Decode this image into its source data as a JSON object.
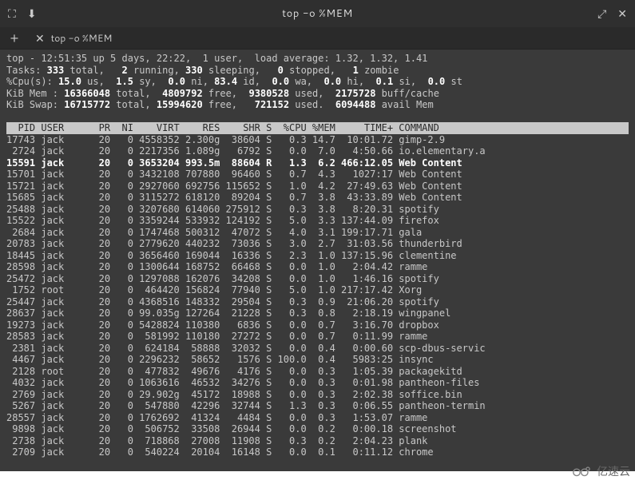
{
  "window": {
    "title": "top -o %MEM",
    "titlebar_icons": {
      "fullscreen": "⛶",
      "download": "⬇",
      "expand": "⤢",
      "close": "✕"
    }
  },
  "tabs": {
    "new_tab_icon": "+",
    "items": [
      {
        "close_icon": "✕",
        "label": "top -o %MEM"
      }
    ]
  },
  "summary": {
    "line1_pre": "top - 12:51:35 up 5 days, 22:22,  1 user,  load average: 1.32, 1.32, 1.41",
    "tasks_label": "Tasks:",
    "tasks_total": "333",
    "tasks_total_suffix": " total,",
    "tasks_running": "2",
    "tasks_running_suffix": " running,",
    "tasks_sleeping": "330",
    "tasks_sleeping_suffix": " sleeping,",
    "tasks_stopped": "0",
    "tasks_stopped_suffix": " stopped,",
    "tasks_zombie": "1",
    "tasks_zombie_suffix": " zombie",
    "cpu_label": "%Cpu(s):",
    "cpu_us": "15.0",
    "cpu_us_suffix": " us,",
    "cpu_sy": "1.5",
    "cpu_sy_suffix": " sy,",
    "cpu_ni": "0.0",
    "cpu_ni_suffix": " ni,",
    "cpu_id": "83.4",
    "cpu_id_suffix": " id,",
    "cpu_wa": "0.0",
    "cpu_wa_suffix": " wa,",
    "cpu_hi": "0.0",
    "cpu_hi_suffix": " hi,",
    "cpu_si": "0.1",
    "cpu_si_suffix": " si,",
    "cpu_st": "0.0",
    "cpu_st_suffix": " st",
    "mem_label": "KiB Mem :",
    "mem_total": "16366048",
    "mem_total_suffix": " total,",
    "mem_free": "4809792",
    "mem_free_suffix": " free,",
    "mem_used": "9380528",
    "mem_used_suffix": " used,",
    "mem_cache": "2175728",
    "mem_cache_suffix": " buff/cache",
    "swap_label": "KiB Swap:",
    "swap_total": "16715772",
    "swap_total_suffix": " total,",
    "swap_free": "15994620",
    "swap_free_suffix": " free,",
    "swap_used": "721152",
    "swap_used_suffix": " used.",
    "swap_avail": "6094488",
    "swap_avail_suffix": " avail Mem"
  },
  "columns": "  PID USER      PR  NI    VIRT    RES    SHR S  %CPU %MEM     TIME+ COMMAND         ",
  "rows": [
    {
      "hl": false,
      "pid": "17743",
      "user": "jack",
      "pr": "20",
      "ni": "0",
      "virt": "4558352",
      "res": "2.300g",
      "shr": "38604",
      "s": "S",
      "cpu": "0.3",
      "mem": "14.7",
      "time": "10:01.72",
      "cmd": "gimp-2.9"
    },
    {
      "hl": false,
      "pid": " 2724",
      "user": "jack",
      "pr": "20",
      "ni": "0",
      "virt": "2217356",
      "res": "1.089g",
      "shr": "6792",
      "s": "S",
      "cpu": "0.0",
      "mem": "7.0",
      "time": "4:50.66",
      "cmd": "io.elementary.a"
    },
    {
      "hl": true,
      "pid": "15591",
      "user": "jack",
      "pr": "20",
      "ni": "0",
      "virt": "3653204",
      "res": "993.5m",
      "shr": "88604",
      "s": "R",
      "cpu": "1.3",
      "mem": "6.2",
      "time": "466:12.05",
      "cmd": "Web Content"
    },
    {
      "hl": false,
      "pid": "15701",
      "user": "jack",
      "pr": "20",
      "ni": "0",
      "virt": "3432108",
      "res": "707880",
      "shr": "96460",
      "s": "S",
      "cpu": "0.7",
      "mem": "4.3",
      "time": "1027:17",
      "cmd": "Web Content"
    },
    {
      "hl": false,
      "pid": "15721",
      "user": "jack",
      "pr": "20",
      "ni": "0",
      "virt": "2927060",
      "res": "692756",
      "shr": "115652",
      "s": "S",
      "cpu": "1.0",
      "mem": "4.2",
      "time": "27:49.63",
      "cmd": "Web Content"
    },
    {
      "hl": false,
      "pid": "15685",
      "user": "jack",
      "pr": "20",
      "ni": "0",
      "virt": "3115272",
      "res": "618120",
      "shr": "89204",
      "s": "S",
      "cpu": "0.7",
      "mem": "3.8",
      "time": "43:33.89",
      "cmd": "Web Content"
    },
    {
      "hl": false,
      "pid": "25488",
      "user": "jack",
      "pr": "20",
      "ni": "0",
      "virt": "3207680",
      "res": "614060",
      "shr": "275912",
      "s": "S",
      "cpu": "0.3",
      "mem": "3.8",
      "time": "8:20.31",
      "cmd": "spotify"
    },
    {
      "hl": false,
      "pid": "15522",
      "user": "jack",
      "pr": "20",
      "ni": "0",
      "virt": "3359244",
      "res": "533932",
      "shr": "124192",
      "s": "S",
      "cpu": "5.0",
      "mem": "3.3",
      "time": "137:44.09",
      "cmd": "firefox"
    },
    {
      "hl": false,
      "pid": " 2684",
      "user": "jack",
      "pr": "20",
      "ni": "0",
      "virt": "1747468",
      "res": "500312",
      "shr": "47072",
      "s": "S",
      "cpu": "4.0",
      "mem": "3.1",
      "time": "199:17.71",
      "cmd": "gala"
    },
    {
      "hl": false,
      "pid": "20783",
      "user": "jack",
      "pr": "20",
      "ni": "0",
      "virt": "2779620",
      "res": "440232",
      "shr": "73036",
      "s": "S",
      "cpu": "3.0",
      "mem": "2.7",
      "time": "31:03.56",
      "cmd": "thunderbird"
    },
    {
      "hl": false,
      "pid": "18445",
      "user": "jack",
      "pr": "20",
      "ni": "0",
      "virt": "3656460",
      "res": "169044",
      "shr": "16336",
      "s": "S",
      "cpu": "2.3",
      "mem": "1.0",
      "time": "137:15.96",
      "cmd": "clementine"
    },
    {
      "hl": false,
      "pid": "28598",
      "user": "jack",
      "pr": "20",
      "ni": "0",
      "virt": "1300644",
      "res": "168752",
      "shr": "66468",
      "s": "S",
      "cpu": "0.0",
      "mem": "1.0",
      "time": "2:04.42",
      "cmd": "ramme"
    },
    {
      "hl": false,
      "pid": "25472",
      "user": "jack",
      "pr": "20",
      "ni": "0",
      "virt": "1297088",
      "res": "162076",
      "shr": "34208",
      "s": "S",
      "cpu": "0.0",
      "mem": "1.0",
      "time": "1:46.16",
      "cmd": "spotify"
    },
    {
      "hl": false,
      "pid": " 1752",
      "user": "root",
      "pr": "20",
      "ni": "0",
      "virt": "464420",
      "res": "156824",
      "shr": "77940",
      "s": "S",
      "cpu": "5.0",
      "mem": "1.0",
      "time": "217:17.42",
      "cmd": "Xorg"
    },
    {
      "hl": false,
      "pid": "25447",
      "user": "jack",
      "pr": "20",
      "ni": "0",
      "virt": "4368516",
      "res": "148332",
      "shr": "29504",
      "s": "S",
      "cpu": "0.3",
      "mem": "0.9",
      "time": "21:06.20",
      "cmd": "spotify"
    },
    {
      "hl": false,
      "pid": "28637",
      "user": "jack",
      "pr": "20",
      "ni": "0",
      "virt": "99.035g",
      "res": "127264",
      "shr": "21228",
      "s": "S",
      "cpu": "0.3",
      "mem": "0.8",
      "time": "2:18.19",
      "cmd": "wingpanel"
    },
    {
      "hl": false,
      "pid": "19273",
      "user": "jack",
      "pr": "20",
      "ni": "0",
      "virt": "5428824",
      "res": "110380",
      "shr": "6836",
      "s": "S",
      "cpu": "0.0",
      "mem": "0.7",
      "time": "3:16.70",
      "cmd": "dropbox"
    },
    {
      "hl": false,
      "pid": "28583",
      "user": "jack",
      "pr": "20",
      "ni": "0",
      "virt": "581992",
      "res": "110180",
      "shr": "27272",
      "s": "S",
      "cpu": "0.0",
      "mem": "0.7",
      "time": "0:11.99",
      "cmd": "ramme"
    },
    {
      "hl": false,
      "pid": " 2381",
      "user": "jack",
      "pr": "20",
      "ni": "0",
      "virt": "624184",
      "res": "58888",
      "shr": "32032",
      "s": "S",
      "cpu": "0.0",
      "mem": "0.4",
      "time": "0:00.60",
      "cmd": "scp-dbus-servic"
    },
    {
      "hl": false,
      "pid": " 4467",
      "user": "jack",
      "pr": "20",
      "ni": "0",
      "virt": "2296232",
      "res": "58652",
      "shr": "1576",
      "s": "S",
      "cpu": "100.0",
      "mem": "0.4",
      "time": "5983:25",
      "cmd": "insync"
    },
    {
      "hl": false,
      "pid": " 2128",
      "user": "root",
      "pr": "20",
      "ni": "0",
      "virt": "477832",
      "res": "49676",
      "shr": "4176",
      "s": "S",
      "cpu": "0.0",
      "mem": "0.3",
      "time": "1:05.39",
      "cmd": "packagekitd"
    },
    {
      "hl": false,
      "pid": " 4032",
      "user": "jack",
      "pr": "20",
      "ni": "0",
      "virt": "1063616",
      "res": "46532",
      "shr": "34276",
      "s": "S",
      "cpu": "0.0",
      "mem": "0.3",
      "time": "0:01.98",
      "cmd": "pantheon-files"
    },
    {
      "hl": false,
      "pid": " 2769",
      "user": "jack",
      "pr": "20",
      "ni": "0",
      "virt": "29.902g",
      "res": "45172",
      "shr": "18988",
      "s": "S",
      "cpu": "0.0",
      "mem": "0.3",
      "time": "2:02.38",
      "cmd": "soffice.bin"
    },
    {
      "hl": false,
      "pid": " 5267",
      "user": "jack",
      "pr": "20",
      "ni": "0",
      "virt": "547880",
      "res": "42296",
      "shr": "32744",
      "s": "S",
      "cpu": "1.3",
      "mem": "0.3",
      "time": "0:06.55",
      "cmd": "pantheon-termin"
    },
    {
      "hl": false,
      "pid": "28557",
      "user": "jack",
      "pr": "20",
      "ni": "0",
      "virt": "1762692",
      "res": "41324",
      "shr": "4484",
      "s": "S",
      "cpu": "0.0",
      "mem": "0.3",
      "time": "1:53.07",
      "cmd": "ramme"
    },
    {
      "hl": false,
      "pid": " 9898",
      "user": "jack",
      "pr": "20",
      "ni": "0",
      "virt": "506752",
      "res": "33508",
      "shr": "26944",
      "s": "S",
      "cpu": "0.0",
      "mem": "0.2",
      "time": "0:00.18",
      "cmd": "screenshot"
    },
    {
      "hl": false,
      "pid": " 2738",
      "user": "jack",
      "pr": "20",
      "ni": "0",
      "virt": "718868",
      "res": "27008",
      "shr": "11908",
      "s": "S",
      "cpu": "0.3",
      "mem": "0.2",
      "time": "2:04.23",
      "cmd": "plank"
    },
    {
      "hl": false,
      "pid": " 2709",
      "user": "jack",
      "pr": "20",
      "ni": "0",
      "virt": "540224",
      "res": "20104",
      "shr": "16148",
      "s": "S",
      "cpu": "0.0",
      "mem": "0.1",
      "time": "0:11.12",
      "cmd": "chrome"
    }
  ],
  "watermark": "亿速云"
}
